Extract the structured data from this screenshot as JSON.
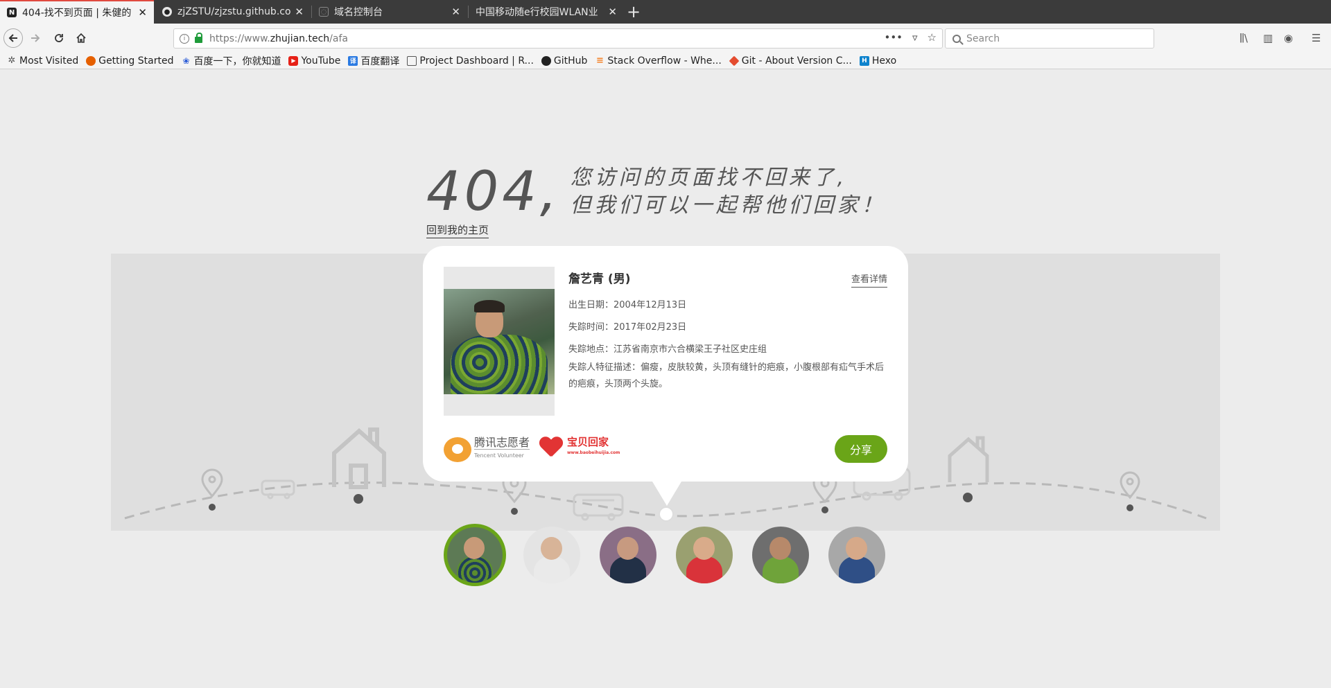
{
  "browser": {
    "tabs": [
      {
        "title": "404-找不到页面 | 朱健的",
        "active": true
      },
      {
        "title": "zjZSTU/zjzstu.github.co",
        "active": false
      },
      {
        "title": "域名控制台",
        "active": false
      },
      {
        "title": "中国移动随e行校园WLAN业",
        "active": false
      }
    ],
    "url_prefix": "https://www.",
    "url_domain": "zhujian.tech",
    "url_path": "/afa",
    "search_placeholder": "Search",
    "bookmarks": [
      {
        "label": "Most Visited",
        "icon": "gear-icon",
        "color": "#555555"
      },
      {
        "label": "Getting Started",
        "icon": "firefox-icon",
        "color": "#e66000"
      },
      {
        "label": "百度一下，你就知道",
        "icon": "baidu-paw-icon",
        "color": "#2a5bd7"
      },
      {
        "label": "YouTube",
        "icon": "youtube-icon",
        "color": "#e62117"
      },
      {
        "label": "百度翻译",
        "icon": "baidu-translate-icon",
        "color": "#2a7ae2"
      },
      {
        "label": "Project Dashboard | R...",
        "icon": "dashboard-icon",
        "color": "#555555"
      },
      {
        "label": "GitHub",
        "icon": "github-icon",
        "color": "#222222"
      },
      {
        "label": "Stack Overflow - Whe...",
        "icon": "stackoverflow-icon",
        "color": "#f48024"
      },
      {
        "label": "Git - About Version C...",
        "icon": "git-icon",
        "color": "#e44c30"
      },
      {
        "label": "Hexo",
        "icon": "hexo-icon",
        "color": "#0e83cd"
      }
    ]
  },
  "page": {
    "big_404": "404,",
    "message_line1": "您访问的页面找不回来了,",
    "message_line2": "但我们可以一起帮他们回家！",
    "home_link": "回到我的主页"
  },
  "card": {
    "name": "詹艺青 (男)",
    "detail_link": "查看详情",
    "birth": "出生日期：2004年12月13日",
    "missing_time": "失踪时间：2017年02月23日",
    "missing_place": "失踪地点：江苏省南京市六合横梁王子社区史庄组",
    "description": "失踪人特征描述：偏瘦，皮肤较黄，头顶有缝针的疤痕，小腹根部有疝气手术后的疤痕，头顶两个头旋。",
    "logo_tencent_cn": "腾讯志愿者",
    "logo_tencent_en": "Tencent Volunteer",
    "logo_baobei_cn": "宝贝回家",
    "logo_baobei_en": "www.baobeihuijia.com",
    "share": "分享"
  },
  "colors": {
    "accent_green": "#6aa518",
    "tab_accent": "#e04a3f"
  }
}
